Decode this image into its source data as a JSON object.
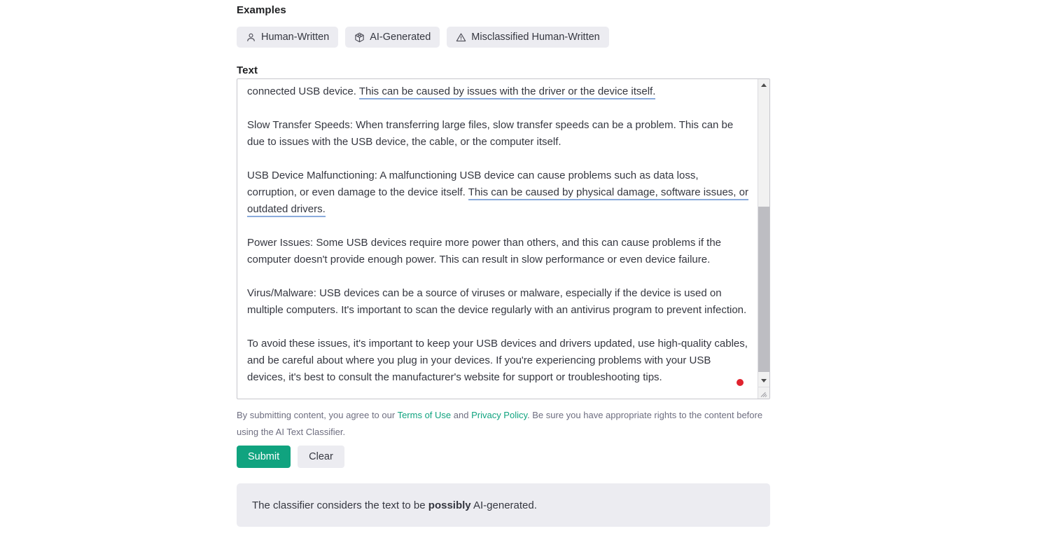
{
  "examples": {
    "label": "Examples",
    "chips": [
      {
        "icon": "person-icon",
        "label": "Human-Written"
      },
      {
        "icon": "cube-icon",
        "label": "AI-Generated"
      },
      {
        "icon": "warning-triangle-icon",
        "label": "Misclassified Human-Written"
      }
    ]
  },
  "text_field": {
    "label": "Text",
    "paragraphs": [
      {
        "segments": [
          {
            "text": "connected USB device. ",
            "highlight": false
          },
          {
            "text": "This can be caused by issues with the driver or the device itself.",
            "highlight": true
          }
        ]
      },
      {
        "segments": [
          {
            "text": "Slow Transfer Speeds: When transferring large files, slow transfer speeds can be a problem. This can be due to issues with the USB device, the cable, or the computer itself.",
            "highlight": false
          }
        ]
      },
      {
        "segments": [
          {
            "text": "USB Device Malfunctioning: A malfunctioning USB device can cause problems such as data loss, corruption, or even damage to the device itself. ",
            "highlight": false
          },
          {
            "text": "This can be caused by physical damage, software issues, or outdated drivers.",
            "highlight": true
          }
        ]
      },
      {
        "segments": [
          {
            "text": "Power Issues: Some USB devices require more power than others, and this can cause problems if the computer doesn't provide enough power. This can result in slow performance or even device failure.",
            "highlight": false
          }
        ]
      },
      {
        "segments": [
          {
            "text": "Virus/Malware: USB devices can be a source of viruses or malware, especially if the device is used on multiple computers. It's important to scan the device regularly with an antivirus program to prevent infection.",
            "highlight": false
          }
        ]
      },
      {
        "segments": [
          {
            "text": "To avoid these issues, it's important to keep your USB devices and drivers updated, use high-quality cables, and be careful about where you plug in your devices. If you're experiencing problems with your USB devices, it's best to consult the manufacturer's website for support or troubleshooting tips.",
            "highlight": false
          }
        ]
      }
    ],
    "scrollbar": {
      "up_arrow": "scroll-up-arrow-icon",
      "down_arrow": "scroll-down-arrow-icon"
    }
  },
  "legal": {
    "part1": "By submitting content, you agree to our ",
    "link1": "Terms of Use",
    "part2": " and ",
    "link2": "Privacy Policy",
    "part3": ". Be sure you have appropriate rights to the content before using the AI Text Classifier."
  },
  "actions": {
    "submit_label": "Submit",
    "clear_label": "Clear"
  },
  "result": {
    "prefix": "The classifier considers the text to be ",
    "emphasis": "possibly",
    "suffix": " AI-generated."
  },
  "colors": {
    "accent": "#10a37f",
    "chip_bg": "#ececf1",
    "panel_bg": "#ececf1",
    "highlight_underline": "#8aabdc",
    "cursor_dot": "#e0232e",
    "text": "#353740",
    "muted_text": "#6e6e80"
  }
}
